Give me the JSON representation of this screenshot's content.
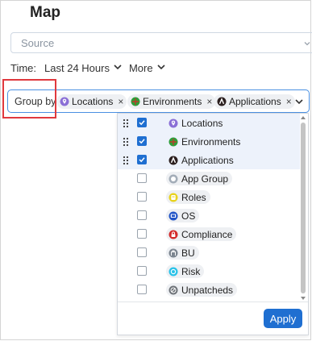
{
  "page": {
    "title": "Map"
  },
  "source": {
    "placeholder": "Source"
  },
  "time": {
    "label": "Time:",
    "value": "Last 24 Hours",
    "more_label": "More"
  },
  "group_by": {
    "label": "Group by",
    "chips": [
      {
        "label": "Locations",
        "icon": "location-pin-icon",
        "remove": "×"
      },
      {
        "label": "Environments",
        "icon": "environments-icon",
        "remove": "×"
      },
      {
        "label": "Applications",
        "icon": "applications-icon",
        "remove": "×"
      }
    ]
  },
  "dropdown": {
    "options": [
      {
        "label": "Locations",
        "icon": "location-pin-icon",
        "checked": true
      },
      {
        "label": "Environments",
        "icon": "environments-icon",
        "checked": true
      },
      {
        "label": "Applications",
        "icon": "applications-icon",
        "checked": true
      },
      {
        "label": "App Group",
        "icon": "app-group-icon",
        "checked": false
      },
      {
        "label": "Roles",
        "icon": "roles-icon",
        "checked": false
      },
      {
        "label": "OS",
        "icon": "os-icon",
        "checked": false
      },
      {
        "label": "Compliance",
        "icon": "compliance-lock-icon",
        "checked": false
      },
      {
        "label": "BU",
        "icon": "bu-icon",
        "checked": false
      },
      {
        "label": "Risk",
        "icon": "risk-icon",
        "checked": false
      },
      {
        "label": "Unpatcheds",
        "icon": "unpatched-icon",
        "checked": false
      }
    ],
    "apply_label": "Apply"
  },
  "colors": {
    "accent": "#1f6fd1",
    "highlight": "#e0393e",
    "locations": "#8a6fd6",
    "environments": "#2e9e3a",
    "applications": "#2b1f1f",
    "app_group": "#a3adb8",
    "roles": "#e8d21e",
    "os": "#2255c7",
    "compliance": "#d32a2a",
    "bu": "#7c8590",
    "risk": "#29c2e8",
    "unpatched": "#6d7278"
  }
}
